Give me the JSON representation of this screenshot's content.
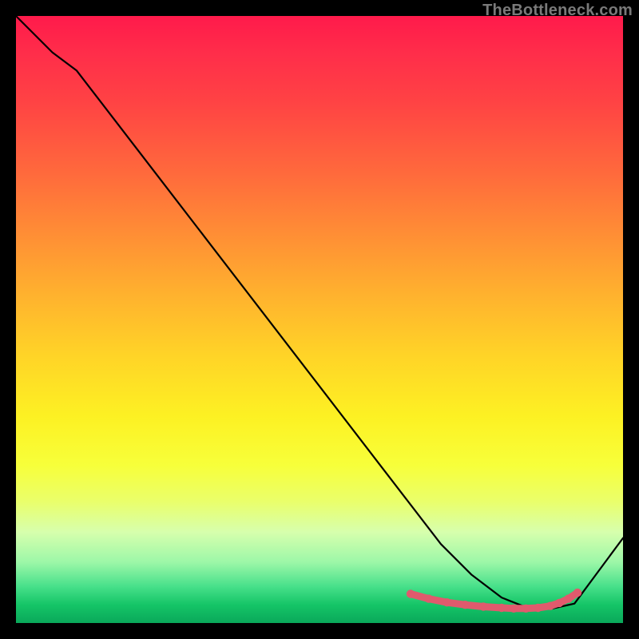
{
  "watermark": "TheBottleneck.com",
  "chart_data": {
    "type": "line",
    "title": "",
    "xlabel": "",
    "ylabel": "",
    "xlim": [
      0,
      100
    ],
    "ylim": [
      0,
      100
    ],
    "grid": false,
    "legend": false,
    "series": [
      {
        "name": "curve",
        "stroke": "#000000",
        "x": [
          0,
          6,
          10,
          20,
          30,
          40,
          50,
          60,
          65,
          70,
          75,
          80,
          84,
          88,
          92,
          100
        ],
        "y": [
          100,
          94,
          91,
          78,
          65,
          52,
          39,
          26,
          19.5,
          13,
          8,
          4.2,
          2.6,
          2.3,
          3.2,
          14
        ]
      },
      {
        "name": "floor-dots",
        "stroke": "#e05a6d",
        "marker": "circle",
        "x": [
          65,
          68,
          71,
          74,
          77,
          80,
          82,
          84,
          86,
          88,
          89.5,
          91,
          92.5
        ],
        "y": [
          4.8,
          4.0,
          3.4,
          3.0,
          2.7,
          2.5,
          2.4,
          2.4,
          2.5,
          2.8,
          3.3,
          4.0,
          5.0
        ]
      }
    ],
    "background_gradient": [
      "#ff1a4b",
      "#ffd427",
      "#f7ff3a",
      "#15c567"
    ]
  }
}
